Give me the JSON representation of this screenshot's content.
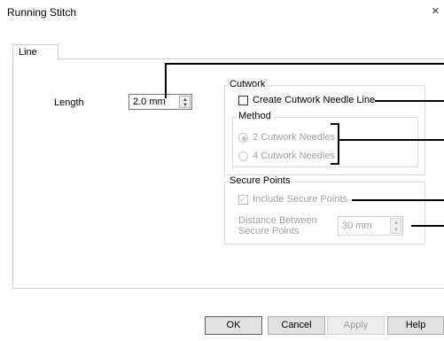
{
  "window": {
    "title": "Running Stitch",
    "close_glyph": "×"
  },
  "tabs": [
    {
      "label": "Line"
    }
  ],
  "length": {
    "label": "Length",
    "value": "2.0 mm"
  },
  "cutwork": {
    "group_label": "Cutwork",
    "create_needle_line": {
      "label": "Create Cutwork Needle Line",
      "checked": false
    },
    "method": {
      "group_label": "Method",
      "options": [
        {
          "label": "2 Cutwork Needles",
          "selected": true,
          "enabled": false
        },
        {
          "label": "4 Cutwork Needles",
          "selected": false,
          "enabled": false
        }
      ]
    }
  },
  "secure_points": {
    "group_label": "Secure Points",
    "include": {
      "label": "Include Secure Points",
      "checked": true,
      "enabled": false
    },
    "distance": {
      "label_line1": "Distance Between",
      "label_line2": "Secure Points",
      "value": "30 mm",
      "enabled": false
    }
  },
  "buttons": {
    "ok": "OK",
    "cancel": "Cancel",
    "apply": "Apply",
    "help": "Help"
  },
  "icons": {
    "spin_up": "▲",
    "spin_down": "▼",
    "check": "✓"
  },
  "colors": {
    "default_button_border": "#0078d7",
    "disabled_text": "#a0a0a0"
  }
}
